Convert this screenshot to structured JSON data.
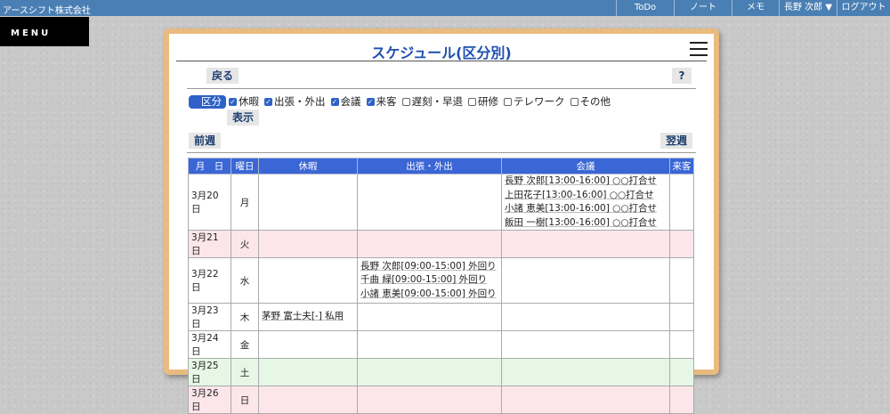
{
  "topbar": {
    "company": "アースシフト株式会社",
    "nav": [
      "ToDo",
      "ノート",
      "メモ",
      "長野 次郎 ▼",
      "ログアウト"
    ]
  },
  "menu_label": "MENU",
  "page": {
    "title": "スケジュール(区分別)",
    "back": "戻る",
    "help": "?",
    "show": "表示",
    "prev_week": "前週",
    "next_week": "翌週"
  },
  "filter": {
    "label": "区分",
    "options": [
      {
        "label": "休暇",
        "checked": true
      },
      {
        "label": "出張・外出",
        "checked": true
      },
      {
        "label": "会議",
        "checked": true
      },
      {
        "label": "来客",
        "checked": true
      },
      {
        "label": "遅刻・早退",
        "checked": false
      },
      {
        "label": "研修",
        "checked": false
      },
      {
        "label": "テレワーク",
        "checked": false
      },
      {
        "label": "その他",
        "checked": false
      }
    ]
  },
  "table": {
    "headers": [
      "月　日",
      "曜日",
      "休暇",
      "出張・外出",
      "会議",
      "来客"
    ],
    "rows": [
      {
        "date": "3月20日",
        "dow": "月",
        "type": "",
        "vacation": [],
        "trip": [],
        "meeting": [
          "長野 次郎[13:00-16:00] ○○打合せ",
          "上田花子[13:00-16:00]  ○○打合せ",
          "小諸 恵美[13:00-16:00] ○○打合せ",
          "飯田 一樹[13:00-16:00] ○○打合せ"
        ],
        "visitor": []
      },
      {
        "date": "3月21日",
        "dow": "火",
        "type": "holiday",
        "vacation": [],
        "trip": [],
        "meeting": [],
        "visitor": []
      },
      {
        "date": "3月22日",
        "dow": "水",
        "type": "",
        "vacation": [],
        "trip": [
          "長野 次郎[09:00-15:00] 外回り",
          "千曲 緑[09:00-15:00]    外回り",
          "小諸 恵美[09:00-15:00] 外回り"
        ],
        "meeting": [],
        "visitor": []
      },
      {
        "date": "3月23日",
        "dow": "木",
        "type": "",
        "vacation": [
          "茅野 富士夫[-] 私用"
        ],
        "trip": [],
        "meeting": [],
        "visitor": []
      },
      {
        "date": "3月24日",
        "dow": "金",
        "type": "",
        "vacation": [],
        "trip": [],
        "meeting": [],
        "visitor": []
      },
      {
        "date": "3月25日",
        "dow": "土",
        "type": "saturday",
        "vacation": [],
        "trip": [],
        "meeting": [],
        "visitor": []
      },
      {
        "date": "3月26日",
        "dow": "日",
        "type": "holiday",
        "vacation": [],
        "trip": [],
        "meeting": [],
        "visitor": []
      }
    ]
  },
  "colors": {
    "topbar": "#4a7fb4",
    "header": "#3a66d6",
    "holiday": "#fde6ea",
    "saturday": "#e6f7e6",
    "card_border": "#e9bb7f"
  }
}
